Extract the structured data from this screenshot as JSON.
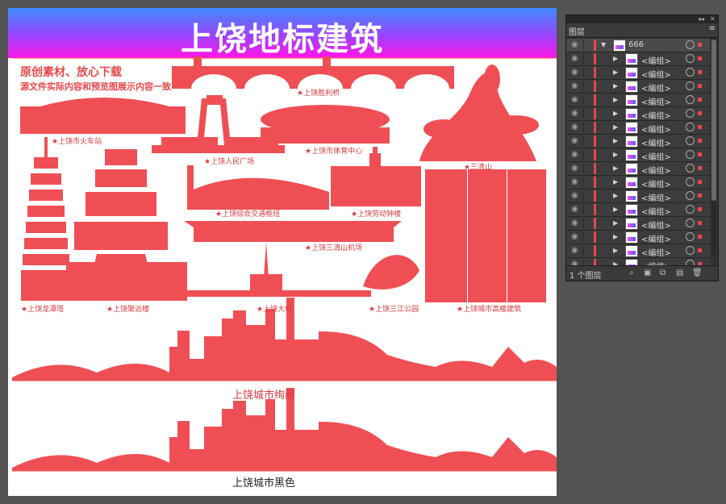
{
  "artboard": {
    "banner_title": "上饶地标建筑",
    "header_line1": "原创素材、放心下载",
    "header_line2": "源文件实际内容和预览图展示内容一致",
    "labels": {
      "bridge_shengli": "★上饶胜利桥",
      "railway_station": "★上饶市火车站",
      "peoples_square": "★上饶人民广场",
      "sports_center": "★上饶市体育中心",
      "sanqingshan": "★三清山",
      "transport_hub": "★上饶综合交通枢纽",
      "clock_tower": "★上饶劳动钟楼",
      "airport": "★上饶三清山机场",
      "longtan_pagoda": "★上饶龙潭塔",
      "juyuan_tower": "★上饶聚远楼",
      "daqiao": "★上饶大桥",
      "sanjiang_park": "★上饶三江公园",
      "highrise": "★上饶城市高楼建筑"
    },
    "caption_color": "上饶城市绚丽",
    "caption_black": "上饶城市黑色"
  },
  "layers_panel": {
    "tab_label": "图层",
    "collapse_glyph": "◂◂",
    "close_glyph": "✕",
    "menu_glyph": "≡",
    "parent_layer": "666",
    "group_label": "<编组>",
    "group_count": 16,
    "footer_count": "1 个图层"
  },
  "colors": {
    "accent": "#ef4f54",
    "label_red": "#d63a3d",
    "panel_bg": "#323232",
    "workspace_bg": "#535353"
  },
  "icons": {
    "visibility": "eye-icon",
    "expand": "triangle-right-icon",
    "target": "target-circle-icon",
    "selection": "selection-square-icon",
    "search": "search-icon",
    "new_layer": "new-layer-icon",
    "delete": "trash-icon"
  }
}
